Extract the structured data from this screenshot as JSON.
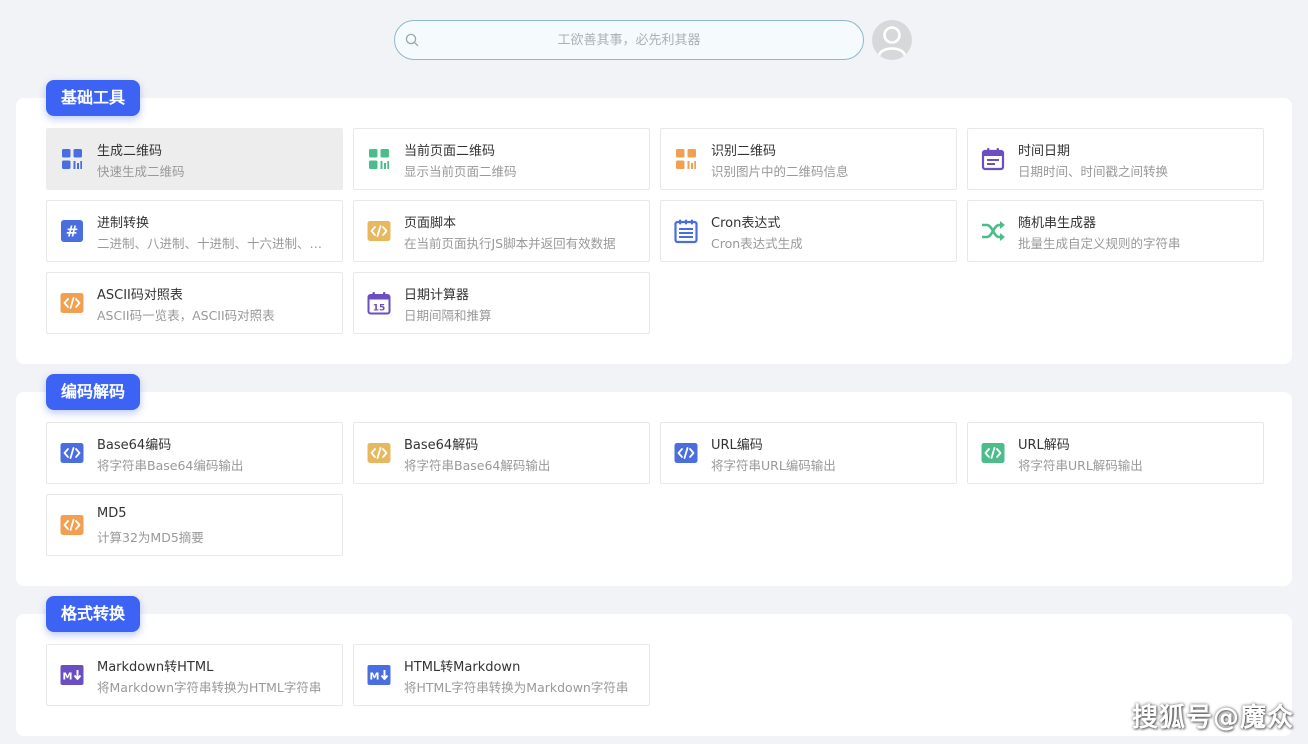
{
  "search": {
    "placeholder": "工欲善其事，必先利其器",
    "value": ""
  },
  "sections": [
    {
      "title": "基础工具",
      "tools": [
        {
          "name": "生成二维码",
          "desc": "快速生成二维码",
          "icon": "qr-grid-icon",
          "color": "#4a6ee0",
          "active": true
        },
        {
          "name": "当前页面二维码",
          "desc": "显示当前页面二维码",
          "icon": "qr-grid-icon",
          "color": "#4cbd8a"
        },
        {
          "name": "识别二维码",
          "desc": "识别图片中的二维码信息",
          "icon": "qr-grid-icon",
          "color": "#f0a050"
        },
        {
          "name": "时间日期",
          "desc": "日期时间、时间戳之间转换",
          "icon": "calendar-icon",
          "color": "#6b4ec2"
        },
        {
          "name": "进制转换",
          "desc": "二进制、八进制、十进制、十六进制、三十六进制转换",
          "icon": "hash-icon",
          "color": "#4a6ee0"
        },
        {
          "name": "页面脚本",
          "desc": "在当前页面执行JS脚本并返回有效数据",
          "icon": "code-icon",
          "color": "#e8b860"
        },
        {
          "name": "Cron表达式",
          "desc": "Cron表达式生成",
          "icon": "notepad-icon",
          "color": "#4a6ee0"
        },
        {
          "name": "随机串生成器",
          "desc": "批量生成自定义规则的字符串",
          "icon": "shuffle-icon",
          "color": "#4cbd8a"
        },
        {
          "name": "ASCII码对照表",
          "desc": "ASCII码一览表，ASCII码对照表",
          "icon": "code-icon",
          "color": "#f0a050"
        },
        {
          "name": "日期计算器",
          "desc": "日期间隔和推算",
          "icon": "calendar-15-icon",
          "color": "#6b4ec2",
          "label": "15"
        }
      ]
    },
    {
      "title": "编码解码",
      "tools": [
        {
          "name": "Base64编码",
          "desc": "将字符串Base64编码输出",
          "icon": "code-icon",
          "color": "#4a6ee0"
        },
        {
          "name": "Base64解码",
          "desc": "将字符串Base64解码输出",
          "icon": "code-icon",
          "color": "#e8b860"
        },
        {
          "name": "URL编码",
          "desc": "将字符串URL编码输出",
          "icon": "code-icon",
          "color": "#4a6ee0"
        },
        {
          "name": "URL解码",
          "desc": "将字符串URL解码输出",
          "icon": "code-icon",
          "color": "#4cbd8a"
        },
        {
          "name": "MD5",
          "desc": "计算32为MD5摘要",
          "icon": "code-icon",
          "color": "#f0a050"
        }
      ]
    },
    {
      "title": "格式转换",
      "tools": [
        {
          "name": "Markdown转HTML",
          "desc": "将Markdown字符串转换为HTML字符串",
          "icon": "markdown-icon",
          "color": "#6b4ec2"
        },
        {
          "name": "HTML转Markdown",
          "desc": "将HTML字符串转换为Markdown字符串",
          "icon": "markdown-icon",
          "color": "#4a6ee0"
        }
      ]
    }
  ],
  "watermark": "搜狐号@魔众"
}
